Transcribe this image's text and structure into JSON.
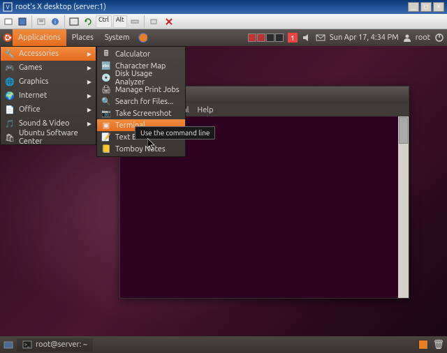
{
  "host_window": {
    "title": "root's X desktop (server:1)",
    "controls": {
      "min": "_",
      "max": "□",
      "close": "×"
    },
    "keys": [
      "Ctrl",
      "Alt"
    ]
  },
  "gnome_panel": {
    "menus": [
      "Applications",
      "Places",
      "System"
    ],
    "notif_count": "1",
    "datetime": "Sun Apr 17,  4:34 PM",
    "user": "root"
  },
  "main_menu": {
    "items": [
      {
        "label": "Accessories",
        "icon": "🔧",
        "sel": true,
        "arrow": true
      },
      {
        "label": "Games",
        "icon": "🎮",
        "arrow": true
      },
      {
        "label": "Graphics",
        "icon": "🌐",
        "arrow": true
      },
      {
        "label": "Internet",
        "icon": "🌍",
        "arrow": true
      },
      {
        "label": "Office",
        "icon": "📄",
        "arrow": true
      },
      {
        "label": "Sound & Video",
        "icon": "🎵",
        "arrow": true
      },
      {
        "label": "Ubuntu Software Center",
        "icon": "🛍"
      }
    ]
  },
  "sub_menu": {
    "items": [
      {
        "label": "Calculator",
        "icon": "🖩"
      },
      {
        "label": "Character Map",
        "icon": "🔤"
      },
      {
        "label": "Disk Usage Analyzer",
        "icon": "💿"
      },
      {
        "label": "Manage Print Jobs",
        "icon": "🖨"
      },
      {
        "label": "Search for Files...",
        "icon": "🔍"
      },
      {
        "label": "Take Screenshot",
        "icon": "📷"
      },
      {
        "label": "Terminal",
        "icon": "▣",
        "sel": true
      },
      {
        "label": "Text Editor",
        "icon": "📝"
      },
      {
        "label": "Tomboy Notes",
        "icon": "📒"
      }
    ]
  },
  "tooltip": "Use the command line",
  "terminal_window": {
    "menu": {
      "0": "al",
      "1": "Help"
    }
  },
  "bottom_panel": {
    "task": "root@server: ~",
    "trash_icon": "🗑"
  }
}
